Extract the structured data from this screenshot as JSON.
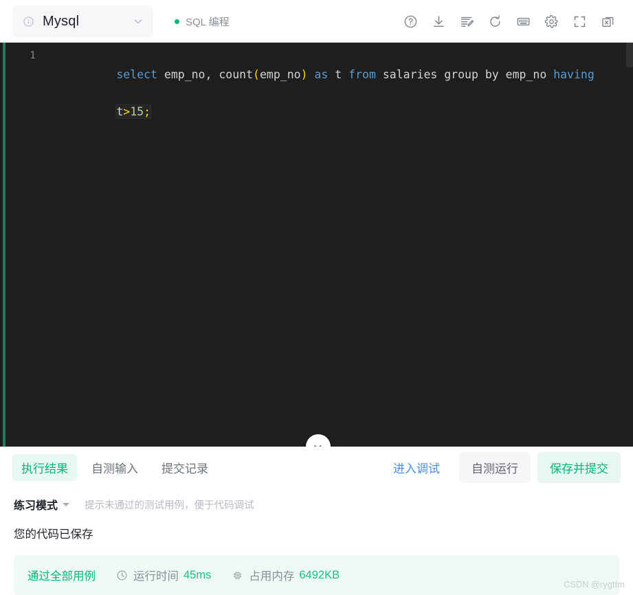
{
  "topbar": {
    "language_select": {
      "value": "Mysql",
      "info_icon": "info-circle-icon",
      "chevron_icon": "chevron-down-icon"
    },
    "mode_tag": {
      "label": "SQL 编程",
      "dot_color": "#00b578"
    },
    "tools": [
      {
        "name": "help-icon",
        "title": "帮助"
      },
      {
        "name": "download-icon",
        "title": "下载"
      },
      {
        "name": "format-code-icon",
        "title": "格式化"
      },
      {
        "name": "refresh-icon",
        "title": "重置"
      },
      {
        "name": "keyboard-icon",
        "title": "快捷键"
      },
      {
        "name": "settings-gear-icon",
        "title": "设置"
      },
      {
        "name": "fullscreen-icon",
        "title": "全屏"
      },
      {
        "name": "window-close-icon",
        "title": "关闭"
      }
    ]
  },
  "editor": {
    "line_number": "1",
    "collapse_icon": "chevron-down-icon",
    "tokens": [
      {
        "t": "select",
        "c": "kw"
      },
      {
        "t": " ",
        "c": "plain"
      },
      {
        "t": "emp_no,",
        "c": "plain"
      },
      {
        "t": " ",
        "c": "plain"
      },
      {
        "t": "count",
        "c": "plain"
      },
      {
        "t": "(",
        "c": "punc"
      },
      {
        "t": "emp_no",
        "c": "plain"
      },
      {
        "t": ")",
        "c": "punc"
      },
      {
        "t": " ",
        "c": "plain"
      },
      {
        "t": "as",
        "c": "kw"
      },
      {
        "t": " t ",
        "c": "plain"
      },
      {
        "t": "from",
        "c": "kw"
      },
      {
        "t": " salaries group by emp_no ",
        "c": "plain"
      },
      {
        "t": "having",
        "c": "kw"
      }
    ],
    "wrapped_tokens": [
      {
        "t": "t",
        "c": "plain"
      },
      {
        "t": ">",
        "c": "punc"
      },
      {
        "t": "15",
        "c": "num"
      },
      {
        "t": ";",
        "c": "punc"
      }
    ],
    "full_code": "select emp_no, count(emp_no) as t from salaries group by emp_no having t>15;",
    "theme": {
      "background": "#1e1e1e",
      "keyword": "#569cd6",
      "text": "#d4d4d4",
      "punctuation": "#ffd700",
      "number": "#b5cea8",
      "gutter": "#858585",
      "accent_stripe": "#2b9a77"
    }
  },
  "bottom": {
    "tabs": [
      {
        "label": "执行结果",
        "active": true
      },
      {
        "label": "自测输入",
        "active": false
      },
      {
        "label": "提交记录",
        "active": false
      }
    ],
    "actions": {
      "debug": "进入调试",
      "self_run": "自测运行",
      "save_submit": "保存并提交"
    },
    "mode": {
      "title": "练习模式",
      "hint": "提示未通过的测试用例，便于代码调试",
      "caret_icon": "caret-down-icon"
    },
    "saved_message": "您的代码已保存",
    "result": {
      "pass_text": "通过全部用例",
      "time_icon": "clock-icon",
      "time_label": "运行时间",
      "time_value": "45ms",
      "memory_icon": "chip-icon",
      "memory_label": "占用内存",
      "memory_value": "6492KB",
      "accent_color": "#00b578",
      "background": "#eef9f4"
    }
  },
  "watermark": "CSDN @rygttm"
}
